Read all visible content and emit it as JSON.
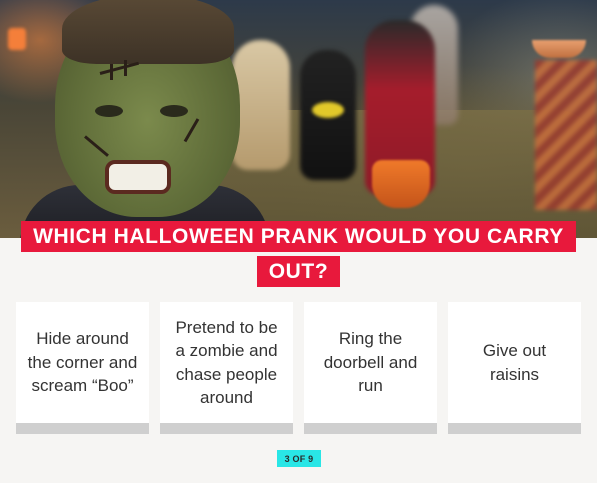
{
  "quiz": {
    "question": "Which Halloween prank would you carry out?",
    "answers": [
      {
        "label": "Hide around the corner and scream “Boo”"
      },
      {
        "label": "Pretend to be a zombie and chase people around"
      },
      {
        "label": "Ring the doorbell and run"
      },
      {
        "label": "Give out raisins"
      }
    ],
    "progress": {
      "text": "3 OF 9",
      "current": 3,
      "total": 9
    }
  },
  "colors": {
    "banner": "#e8193c",
    "progress_badge": "#29e6e6",
    "card_bar": "#cfcfcf",
    "page_background": "#f6f5f3"
  }
}
